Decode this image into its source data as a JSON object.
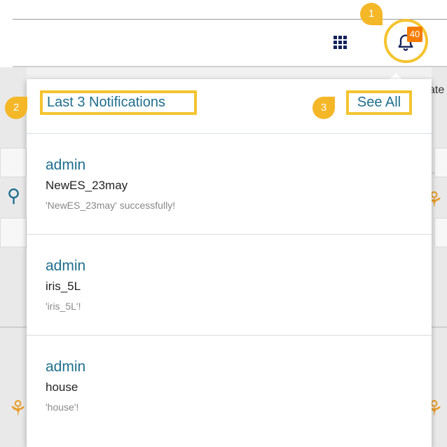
{
  "header": {
    "apps_icon": "grid-apps-icon",
    "bell_icon": "bell-icon",
    "notification_count": "40"
  },
  "background": {
    "partial_label": "ate"
  },
  "dropdown": {
    "title": "Last 3 Notifications",
    "see_all_label": "See All",
    "items": [
      {
        "user": "admin",
        "name": "NewES_23may",
        "message": "'NewES_23may' successfully!"
      },
      {
        "user": "admin",
        "name": "iris_5L",
        "message": "'iris_5L'!"
      },
      {
        "user": "admin",
        "name": "house",
        "message": "'house'!"
      }
    ]
  },
  "callouts": {
    "step1": "1",
    "step2": "2",
    "step3": "3"
  },
  "colors": {
    "accent_highlight": "#f4c430",
    "badge": "#f57c00",
    "link_text": "#1f6f8e",
    "icon_dark": "#13235a"
  }
}
